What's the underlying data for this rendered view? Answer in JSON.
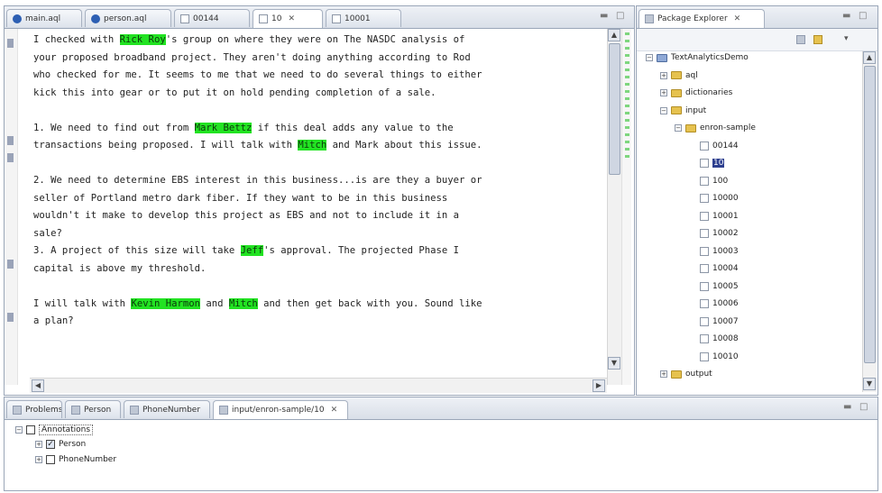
{
  "editor": {
    "tabs": [
      {
        "label": "main.aql",
        "icon": "java-icon"
      },
      {
        "label": "person.aql",
        "icon": "java-icon"
      },
      {
        "label": "00144",
        "icon": "file-icon"
      },
      {
        "label": "10",
        "icon": "file-icon",
        "active": true
      },
      {
        "label": "10001",
        "icon": "file-icon"
      }
    ],
    "close_glyph": "✕",
    "lines": [
      [
        {
          "t": "I checked with "
        },
        {
          "t": "Rick Roy",
          "h": true
        },
        {
          "t": "'s group on where they were on The NASDC analysis of"
        }
      ],
      [
        {
          "t": "your proposed broadband project. They aren't doing anything according to Rod"
        }
      ],
      [
        {
          "t": "who checked for me. It seems to me that we need to do several things to either"
        }
      ],
      [
        {
          "t": "kick this into gear or to put it on hold pending completion of a sale."
        }
      ],
      [],
      [
        {
          "t": "1. We need to find out from "
        },
        {
          "t": "Mark Bettz",
          "h": true
        },
        {
          "t": " if this deal adds any value to the"
        }
      ],
      [
        {
          "t": "transactions being proposed. I will talk with "
        },
        {
          "t": "Mitch",
          "h": true
        },
        {
          "t": " and Mark about this issue."
        }
      ],
      [],
      [
        {
          "t": "2. We need to determine EBS interest in this business...is are they a buyer or"
        }
      ],
      [
        {
          "t": "seller of Portland metro dark fiber. If they want to be in this business"
        }
      ],
      [
        {
          "t": "wouldn't it make to develop this project as EBS and not to include it in a"
        }
      ],
      [
        {
          "t": "sale?"
        }
      ],
      [
        {
          "t": "3. A project of this size will take "
        },
        {
          "t": "Jeff",
          "h": true
        },
        {
          "t": "'s approval. The projected Phase I"
        }
      ],
      [
        {
          "t": "capital is above my threshold."
        }
      ],
      [],
      [
        {
          "t": "I will talk with "
        },
        {
          "t": "Kevin Harmon",
          "h": true
        },
        {
          "t": " and "
        },
        {
          "t": "Mitch",
          "h": true
        },
        {
          "t": " and then get back with you. Sound like"
        }
      ],
      [
        {
          "t": "a plan?"
        }
      ]
    ]
  },
  "package_explorer": {
    "title": "Package Explorer",
    "close_glyph": "✕",
    "tree": [
      {
        "label": "TextAnalyticsDemo",
        "level": 0,
        "twisty": "−",
        "icon": "project-icon"
      },
      {
        "label": "aql",
        "level": 1,
        "twisty": "+",
        "icon": "folder-icon"
      },
      {
        "label": "dictionaries",
        "level": 1,
        "twisty": "+",
        "icon": "folder-icon"
      },
      {
        "label": "input",
        "level": 1,
        "twisty": "−",
        "icon": "folder-icon"
      },
      {
        "label": "enron-sample",
        "level": 2,
        "twisty": "−",
        "icon": "folder-icon"
      },
      {
        "label": "00144",
        "level": 3,
        "icon": "file-icon"
      },
      {
        "label": "10",
        "level": 3,
        "icon": "file-icon",
        "selected": true
      },
      {
        "label": "100",
        "level": 3,
        "icon": "file-icon"
      },
      {
        "label": "10000",
        "level": 3,
        "icon": "file-icon"
      },
      {
        "label": "10001",
        "level": 3,
        "icon": "file-icon"
      },
      {
        "label": "10002",
        "level": 3,
        "icon": "file-icon"
      },
      {
        "label": "10003",
        "level": 3,
        "icon": "file-icon"
      },
      {
        "label": "10004",
        "level": 3,
        "icon": "file-icon"
      },
      {
        "label": "10005",
        "level": 3,
        "icon": "file-icon"
      },
      {
        "label": "10006",
        "level": 3,
        "icon": "file-icon"
      },
      {
        "label": "10007",
        "level": 3,
        "icon": "file-icon"
      },
      {
        "label": "10008",
        "level": 3,
        "icon": "file-icon"
      },
      {
        "label": "10010",
        "level": 3,
        "icon": "file-icon"
      },
      {
        "label": "output",
        "level": 1,
        "twisty": "+",
        "icon": "folder-icon"
      }
    ]
  },
  "bottom": {
    "tabs": [
      {
        "label": "Problems"
      },
      {
        "label": "Person"
      },
      {
        "label": "PhoneNumber"
      },
      {
        "label": "input/enron-sample/10",
        "active": true
      }
    ],
    "close_glyph": "✕",
    "tree": [
      {
        "label": "Annotations",
        "level": 0,
        "twisty": "−",
        "checked": false
      },
      {
        "label": "Person",
        "level": 1,
        "twisty": "+",
        "checked": true
      },
      {
        "label": "PhoneNumber",
        "level": 1,
        "twisty": "+",
        "checked": false
      }
    ]
  },
  "colors": {
    "highlight": "#22e322",
    "selection": "#2d3f8f",
    "chrome": "#dde3ec"
  }
}
